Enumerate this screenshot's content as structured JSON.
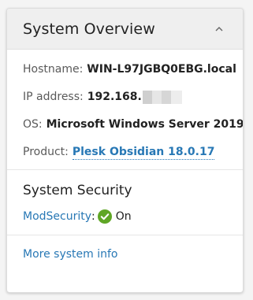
{
  "header": {
    "title": "System Overview",
    "collapse_icon": "chevron-up-icon"
  },
  "info": {
    "hostname": {
      "label": "Hostname:",
      "value": "WIN-L97JGBQ0EBG.local"
    },
    "ip": {
      "label": "IP address:",
      "value": "192.168."
    },
    "os": {
      "label": "OS:",
      "value": "Microsoft Windows Server 2019"
    },
    "product": {
      "label": "Product:",
      "value": "Plesk Obsidian 18.0.17"
    }
  },
  "security": {
    "title": "System Security",
    "modsecurity_label": "ModSecurity",
    "separator": ":",
    "status": "On",
    "status_icon": "check-circle-icon",
    "status_color": "#5fa625"
  },
  "footer": {
    "more_link": "More system info"
  },
  "colors": {
    "link": "#2878b5",
    "header_bg": "#efefef"
  }
}
